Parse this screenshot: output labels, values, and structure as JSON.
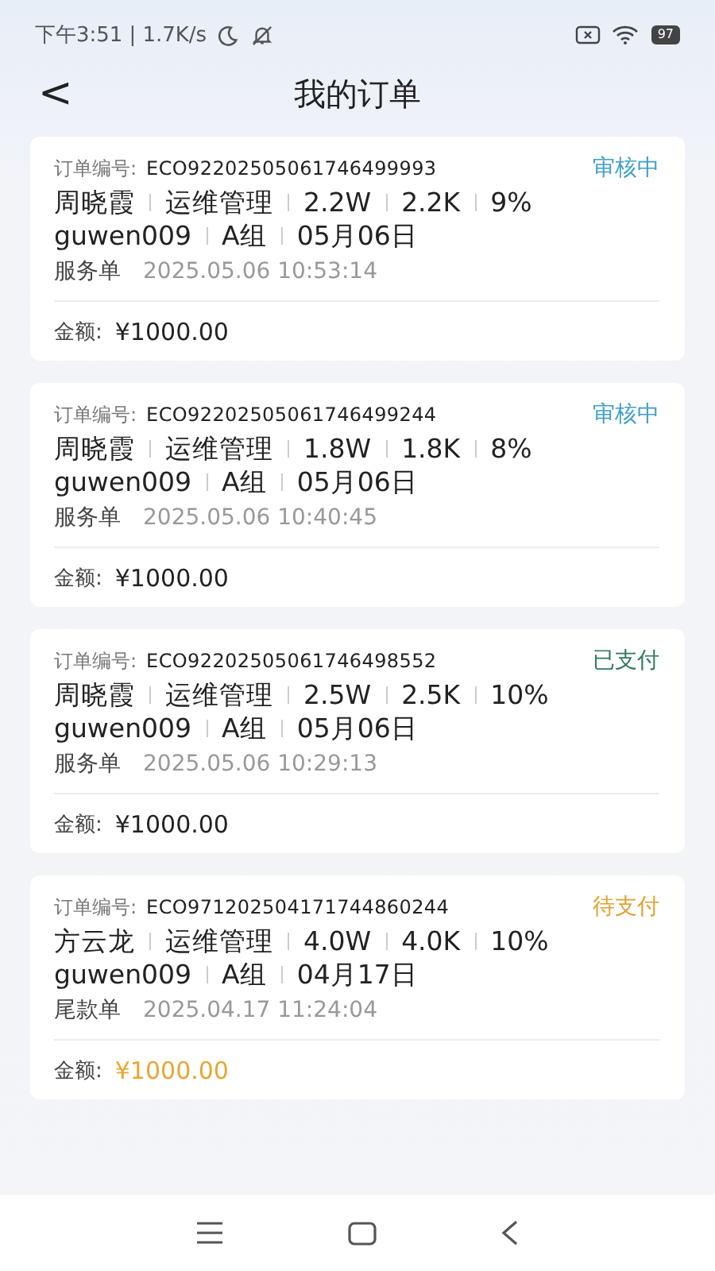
{
  "status_bar": {
    "time": "下午3:51",
    "speed": "| 1.7K/s",
    "battery": "97"
  },
  "header": {
    "back": "<",
    "title": "我的订单"
  },
  "orders": [
    {
      "number_label": "订单编号:",
      "number": "ECO92202505061746499993",
      "status": "审核中",
      "color": "#3f9fc8",
      "line1": [
        "周晓霞",
        "运维管理",
        "2.2W",
        "2.2K",
        "9%"
      ],
      "line2": [
        "guwen009",
        "A组",
        "05月06日"
      ],
      "type": "服务单",
      "time": "2025.05.06 10:53:14",
      "amount_label": "金额:",
      "amount": "¥1000.00",
      "amount_highlighted": false
    },
    {
      "number_label": "订单编号:",
      "number": "ECO92202505061746499244",
      "status": "审核中",
      "color": "#3f9fc8",
      "line1": [
        "周晓霞",
        "运维管理",
        "1.8W",
        "1.8K",
        "8%"
      ],
      "line2": [
        "guwen009",
        "A组",
        "05月06日"
      ],
      "type": "服务单",
      "time": "2025.05.06 10:40:45",
      "amount_label": "金额:",
      "amount": "¥1000.00",
      "amount_highlighted": false
    },
    {
      "number_label": "订单编号:",
      "number": "ECO92202505061746498552",
      "status": "已支付",
      "color": "#2f7a5c",
      "line1": [
        "周晓霞",
        "运维管理",
        "2.5W",
        "2.5K",
        "10%"
      ],
      "line2": [
        "guwen009",
        "A组",
        "05月06日"
      ],
      "type": "服务单",
      "time": "2025.05.06 10:29:13",
      "amount_label": "金额:",
      "amount": "¥1000.00",
      "amount_highlighted": false
    },
    {
      "number_label": "订单编号:",
      "number": "ECO971202504171744860244",
      "status": "待支付",
      "color": "#e0a232",
      "line1": [
        "方云龙",
        "运维管理",
        "4.0W",
        "4.0K",
        "10%"
      ],
      "line2": [
        "guwen009",
        "A组",
        "04月17日"
      ],
      "type": "尾款单",
      "time": "2025.04.17 11:24:04",
      "amount_label": "金额:",
      "amount": "¥1000.00",
      "amount_highlighted": true
    }
  ]
}
